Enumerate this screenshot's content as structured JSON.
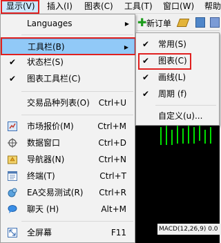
{
  "menubar": {
    "items": [
      "显示(V)",
      "插入(I)",
      "图表(C)",
      "工具(T)",
      "窗口(W)",
      "帮助"
    ]
  },
  "toolbar": {
    "new_order": "新订单"
  },
  "view_menu": {
    "languages": "Languages",
    "toolbars": "工具栏(B)",
    "status_bar": "状态栏(S)",
    "charts_bar": "图表工具栏(C)",
    "symbols": {
      "label": "交易品种列表(O)",
      "shortcut": "Ctrl+U"
    },
    "market_watch": {
      "label": "市场报价(M)",
      "shortcut": "Ctrl+M"
    },
    "data_window": {
      "label": "数据窗口",
      "shortcut": "Ctrl+D"
    },
    "navigator": {
      "label": "导航器(N)",
      "shortcut": "Ctrl+N"
    },
    "terminal": {
      "label": "终端(T)",
      "shortcut": "Ctrl+T"
    },
    "tester": {
      "label": "EA交易测试(R)",
      "shortcut": "Ctrl+R"
    },
    "chat": {
      "label": "聊天 (H)",
      "shortcut": "Alt+M"
    },
    "fullscreen": {
      "label": "全屏幕",
      "shortcut": "F11"
    }
  },
  "toolbars_submenu": {
    "standard": "常用(S)",
    "charts": "图表(C)",
    "line_studies": "画线(L)",
    "periods": "周期 (f)",
    "customize": "自定义(u)..."
  },
  "chart": {
    "macd_label": "MACD(12,26,9) 0.0"
  },
  "colors": {
    "highlight": "#91c9f7",
    "annotation": "#e0201f",
    "candles": "#00e000"
  }
}
